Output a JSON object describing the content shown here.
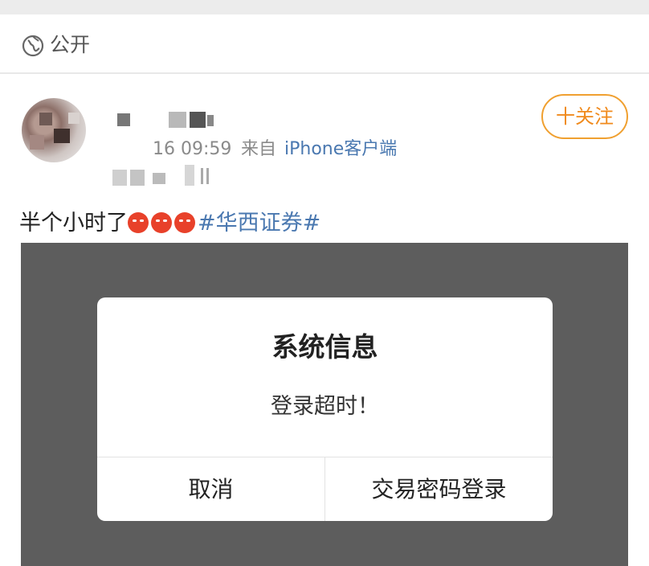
{
  "visibility": {
    "icon": "globe-icon",
    "label": "公开"
  },
  "post": {
    "time": "16 09:59",
    "source_prefix": "来自",
    "source": "iPhone客户端",
    "follow_label": "十关注",
    "text": "半个小时了",
    "emoji_icon": "angry-face-icon",
    "emoji_count": 3,
    "hashtag": "#华西证券#"
  },
  "dialog": {
    "title": "系统信息",
    "message": "登录超时！",
    "cancel_label": "取消",
    "confirm_label": "交易密码登录"
  },
  "colors": {
    "accent": "#f08a1c",
    "link": "#4a78b0",
    "panel": "#5d5d5d",
    "emoji": "#e8412a"
  }
}
